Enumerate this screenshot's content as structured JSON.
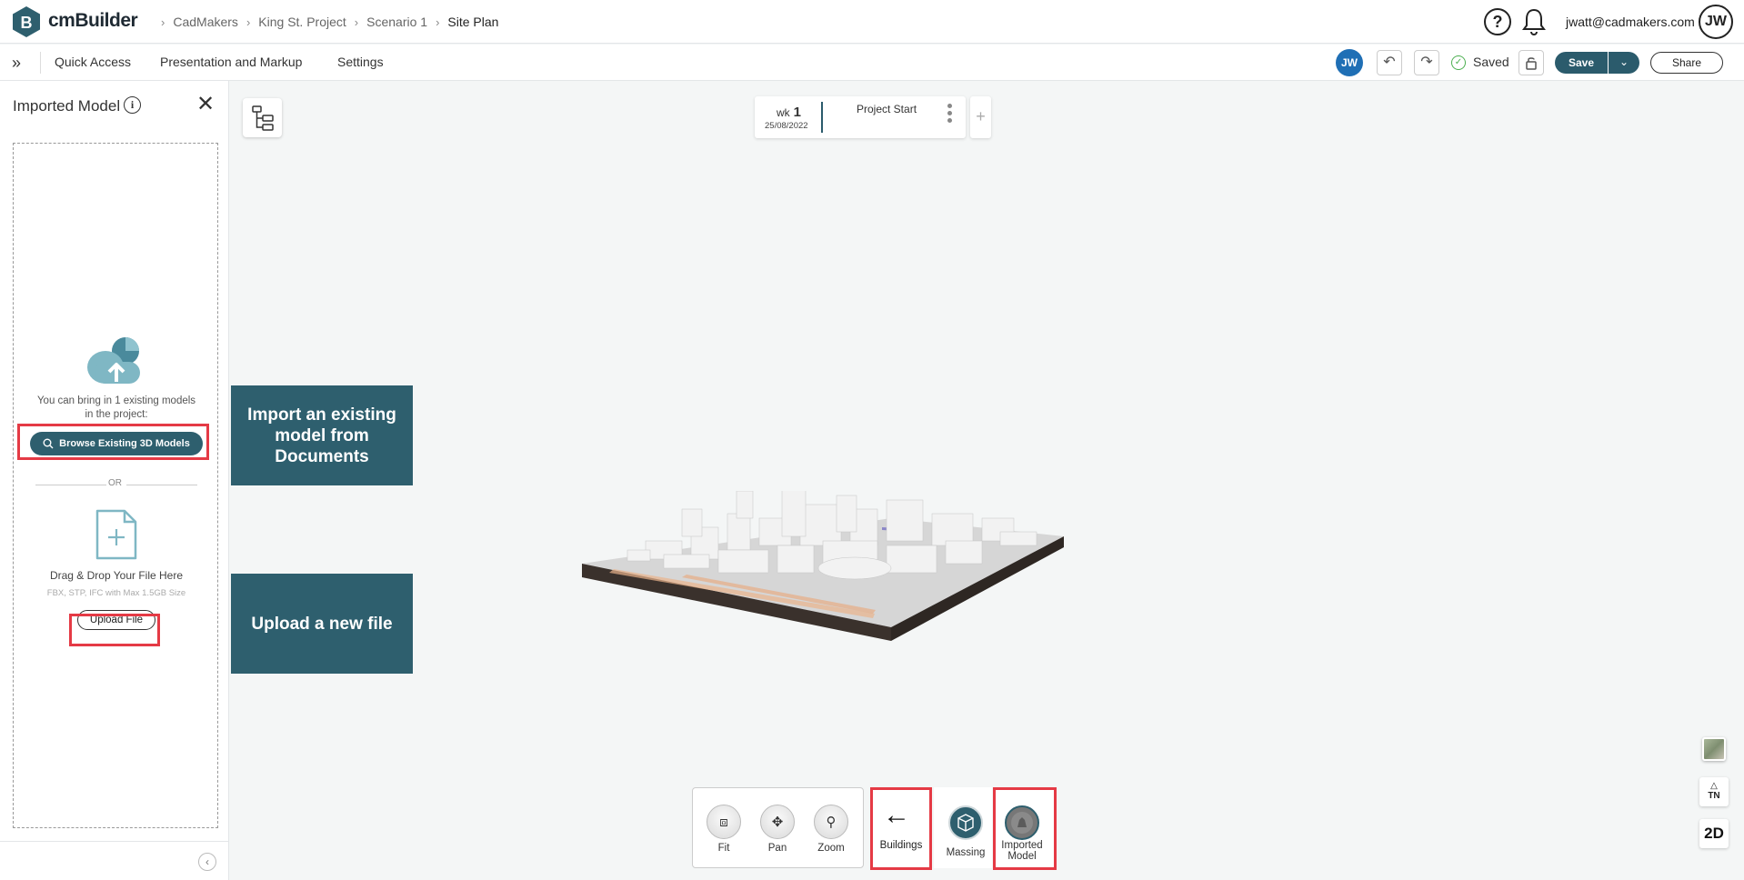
{
  "app": {
    "name": "cmBuilder"
  },
  "breadcrumb": [
    "CadMakers",
    "King St. Project",
    "Scenario 1",
    "Site Plan"
  ],
  "header": {
    "help": "?",
    "user_email": "jwatt@cadmakers.com",
    "avatar_initials": "JW"
  },
  "menu": {
    "items": [
      "Quick Access",
      "Presentation and Markup",
      "Settings"
    ]
  },
  "toolbar_right": {
    "collaborator_initials": "JW",
    "status": "Saved",
    "save_label": "Save",
    "share_label": "Share"
  },
  "panel": {
    "title": "Imported Model",
    "bring_text": "You can bring in 1 existing models in the project:",
    "browse_label": "Browse Existing 3D Models",
    "or_text": "OR",
    "drag_text": "Drag & Drop Your File Here",
    "format_text": "FBX, STP, IFC with Max 1.5GB Size",
    "upload_label": "Upload File"
  },
  "timeline": {
    "wk_prefix": "wk",
    "wk_number": "1",
    "date": "25/08/2022",
    "milestone": "Project Start",
    "add": "+"
  },
  "callouts": [
    "Import an existing model from Documents",
    "Upload a new file"
  ],
  "view_tools": [
    {
      "label": "Fit",
      "icon": "fit-icon"
    },
    {
      "label": "Pan",
      "icon": "pan-icon"
    },
    {
      "label": "Zoom",
      "icon": "zoom-icon"
    }
  ],
  "mode_tools": {
    "buildings": "Buildings",
    "massing": "Massing",
    "imported": "Imported Model"
  },
  "side_controls": {
    "north": "TN",
    "view_2d": "2D"
  },
  "colors": {
    "brand": "#2e5f6e",
    "highlight": "#e53a45",
    "avatar_blue": "#1f6fb5"
  }
}
